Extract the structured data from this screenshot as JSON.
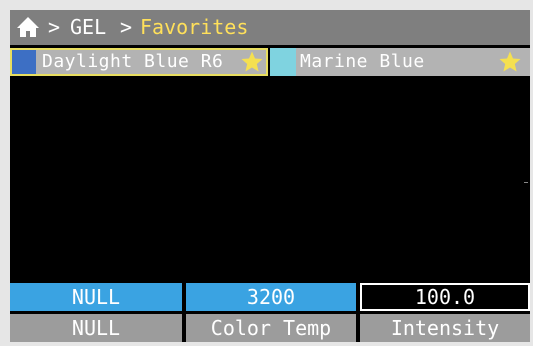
{
  "breadcrumb": {
    "home_icon": "home-icon",
    "separator": ">",
    "level1": "GEL",
    "level2": "Favorites"
  },
  "favorites": [
    {
      "label": "Daylight Blue R6",
      "swatch_color": "#3d6fc4",
      "starred": true,
      "selected": true
    },
    {
      "label": "Marine Blue",
      "swatch_color": "#7fd3e0",
      "starred": true,
      "selected": false
    }
  ],
  "colors": {
    "star": "#f5e050",
    "accent_value": "#3aa3e2",
    "breadcrumb_active": "#ffe05a"
  },
  "bottom_bar": {
    "values": [
      "NULL",
      "3200",
      "100.0"
    ],
    "labels": [
      "NULL",
      "Color Temp",
      "Intensity"
    ]
  }
}
